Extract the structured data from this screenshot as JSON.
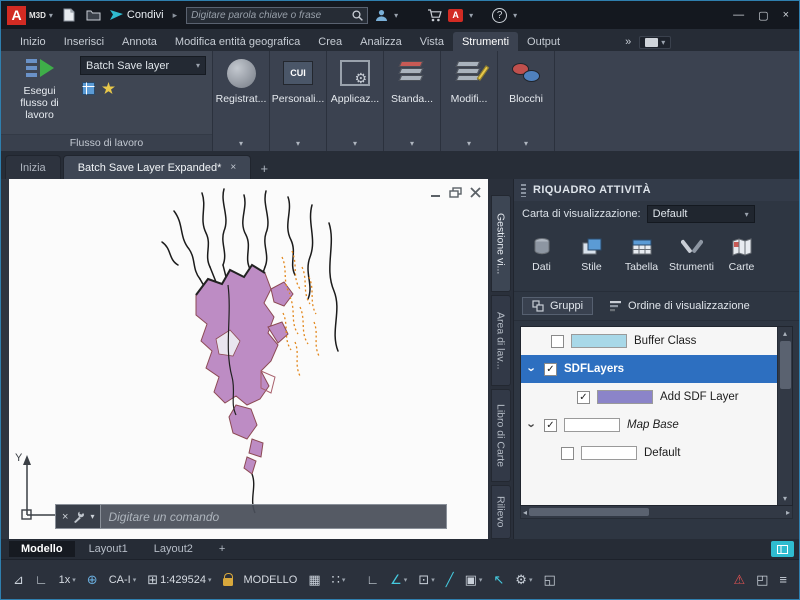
{
  "titlebar": {
    "logo": "A",
    "logo_badge": "M3D",
    "share_label": "Condivi",
    "search_placeholder": "Digitare parola chiave o frase",
    "help_label": "?"
  },
  "icons": {
    "caret": "▾",
    "overflow": "»",
    "plus": "+",
    "close": "×",
    "minimize": "—",
    "maximize": "▢",
    "check": "✓",
    "chevron": "›",
    "up": "▴",
    "down": "▾",
    "left": "◂",
    "right": "▸",
    "gear": "⚙"
  },
  "ribbon_tabs": [
    {
      "label": "Inizio"
    },
    {
      "label": "Inserisci"
    },
    {
      "label": "Annota"
    },
    {
      "label": "Modifica entità geografica"
    },
    {
      "label": "Crea"
    },
    {
      "label": "Analizza"
    },
    {
      "label": "Vista"
    },
    {
      "label": "Strumenti"
    },
    {
      "label": "Output"
    }
  ],
  "ribbon": {
    "workflow": {
      "run_line1": "Esegui",
      "run_line2": "flusso di lavoro",
      "combo_value": "Batch Save layer",
      "panel_label": "Flusso di lavoro"
    },
    "buttons": [
      {
        "label": "Registrat..."
      },
      {
        "label": "Personali...",
        "icon_text": "CUI"
      },
      {
        "label": "Applicaz..."
      },
      {
        "label": "Standa..."
      },
      {
        "label": "Modifi..."
      },
      {
        "label": "Blocchi"
      }
    ]
  },
  "doc_tabs": {
    "start_tab": "Inizia",
    "active_tab": "Batch Save Layer Expanded*"
  },
  "taskpane": {
    "title": "RIQUADRO ATTIVITÀ",
    "display_label": "Carta di visualizzazione:",
    "display_value": "Default",
    "tools": [
      {
        "label": "Dati"
      },
      {
        "label": "Stile"
      },
      {
        "label": "Tabella"
      },
      {
        "label": "Strumenti"
      },
      {
        "label": "Carte"
      }
    ],
    "groups_label": "Gruppi",
    "draw_order_label": "Ordine di visualizzazione",
    "layers": [
      {
        "name": "Buffer Class",
        "check": "",
        "swatch": "#a8d8e8"
      },
      {
        "name": "SDFLayers",
        "check": "✓",
        "selected": true
      },
      {
        "name": "Add SDF Layer",
        "check": "✓",
        "swatch": "#8b84c9"
      },
      {
        "name": "Map Base",
        "check": "✓",
        "swatch": "#ffffff",
        "italic": true
      },
      {
        "name": "Default",
        "check": "",
        "swatch": "#ffffff"
      }
    ],
    "side_tabs": [
      {
        "label": "Gestione vi..."
      },
      {
        "label": "Area di lav..."
      },
      {
        "label": "Libro di Carte"
      },
      {
        "label": "Rilievo"
      }
    ]
  },
  "canvas": {
    "command_placeholder": "Digitare un comando",
    "ucs_y_label": "Y"
  },
  "layout_tabs": [
    {
      "label": "Modello"
    },
    {
      "label": "Layout1"
    },
    {
      "label": "Layout2"
    }
  ],
  "statusbar": {
    "items": [
      {
        "glyph": "⊿",
        "name": "drafting-settings"
      },
      {
        "glyph": "∟",
        "name": "snap-angle"
      },
      {
        "label": "1x",
        "dropdown": "▾",
        "name": "lod-scale"
      },
      {
        "glyph": "⊕",
        "name": "geolocation"
      },
      {
        "label": "CA-I",
        "dropdown": "▾",
        "name": "coordinate-system"
      },
      {
        "glyph": "⊞",
        "label": "1:429524",
        "dropdown": "▾",
        "name": "map-scale"
      },
      {
        "name": "interface-lock"
      },
      {
        "label": "MODELLO",
        "name": "model-space"
      },
      {
        "glyph": "▦",
        "name": "grid-display"
      },
      {
        "glyph": "∷",
        "dropdown": "▾",
        "name": "snap-mode"
      },
      {
        "glyph": "∟",
        "name": "ortho-mode"
      },
      {
        "glyph": "∠",
        "dropdown": "▾",
        "name": "polar-tracking"
      },
      {
        "glyph": "⊡",
        "dropdown": "▾",
        "name": "object-snap"
      },
      {
        "glyph": "╱",
        "name": "lineweight"
      },
      {
        "glyph": "▣",
        "dropdown": "▾",
        "name": "annotation-visibility"
      },
      {
        "glyph": "↖",
        "name": "selection-cycling"
      },
      {
        "glyph": "⚙",
        "dropdown": "▾",
        "name": "customization"
      },
      {
        "glyph": "◱",
        "name": "isolate-objects"
      },
      {
        "glyph": "⚠",
        "name": "performance-warning"
      },
      {
        "glyph": "◰",
        "name": "clean-screen"
      },
      {
        "glyph": "≡",
        "name": "status-menu"
      }
    ]
  },
  "colors": {
    "accent_teal": "#2fbcd0",
    "selection_blue": "#2d6fc0",
    "map_purple": "#bd8cc4",
    "map_orange": "#e2871c",
    "warning_red": "#e05252"
  }
}
